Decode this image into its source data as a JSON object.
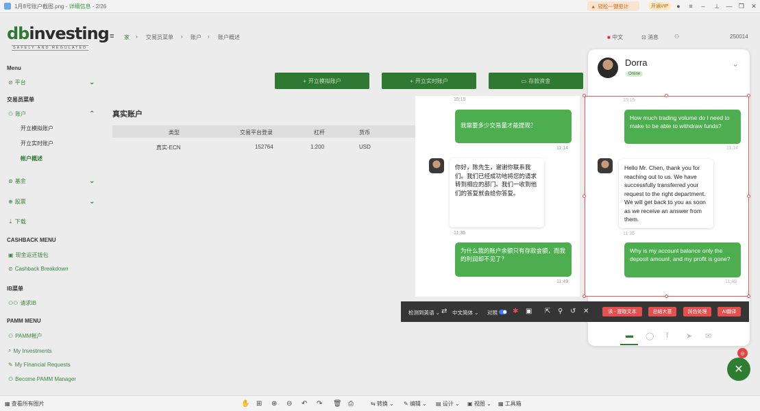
{
  "viewer": {
    "title": "1月8号账户截图.png",
    "title_sep": " - ",
    "title_status": "详细信息",
    "counter": " - 2/26",
    "promo": "轻松一键抠计",
    "vip": "开通VIP"
  },
  "app": {
    "logo_prefix": "db",
    "logo_main": "investing",
    "logo_sub": "SAFELY AND REGULATED",
    "breadcrumbs": [
      "家",
      "交易员菜单",
      "账户",
      "账户概述"
    ],
    "lang": "中文",
    "messages": "消息",
    "account_id": "250014",
    "sidebar": {
      "menu_title": "Menu",
      "platform": "平台",
      "trader_menu": "交易员菜单",
      "accounts": "账户",
      "open_demo": "开立模拟账户",
      "open_live": "开立实时账户",
      "account_overview": "帐户概述",
      "funds": "基金",
      "stocks": "股票",
      "download": "下载",
      "cashback_menu": "CASHBACK MENU",
      "cashback_wallet": "现金返还钱包",
      "cashback_breakdown": "Cashback Breakdown",
      "ib_menu": "IB菜单",
      "request_ib": "请求IB",
      "pamm_menu": "PAMM MENU",
      "pamm_account": "PAMM帐户",
      "my_investments": "My Investments",
      "my_financial_requests": "My Financial Requests",
      "become_pamm": "Become PAMM Manager"
    },
    "buttons": {
      "open_demo": "开立模拟账户",
      "open_live": "开立实时账户",
      "deposit": "存款资金"
    },
    "section_title": "真实账户",
    "table": {
      "headers": [
        "类型",
        "交易平台登录",
        "杠杆",
        "货币"
      ],
      "rows": [
        [
          "真实-ECN",
          "152764",
          "1:200",
          "USD"
        ]
      ]
    },
    "bottom_bar": {
      "view_all": "查看所有图片",
      "convert": "转换",
      "edit": "编辑",
      "design": "设计",
      "view": "视图",
      "toolbox": "工具箱"
    }
  },
  "chat": {
    "agent_name": "Dorra",
    "status": "Online",
    "left_pane": {
      "t1": "15:15",
      "m1": "我需要多少交易量才能提现？",
      "t2": "11:14",
      "m2": "你好，陈先生，谢谢你联系我们。我们已经成功地将您的请求转到相应的部门。我们一收到他们的答复就会给你答复。",
      "t3": "11:36",
      "m3": "为什么我的账户余额只有存款金额，而我的利润却不见了？",
      "t4": "11:49"
    },
    "right_pane": {
      "t1": "15:15",
      "m1": "How much trading volume do I need to make to be able to withdraw funds?",
      "t2": "11:14",
      "m2": "Hello Mr. Chen, thank you for reaching out to us. We have successfully transferred your request to the right department. We will get back to you as soon as we receive an answer from them.",
      "t3": "11:36",
      "m3": "Why is my account balance only the deposit amount, and my profit is gone?",
      "t4": "11:49"
    }
  },
  "translate_toolbar": {
    "source": "检测到英语",
    "target": "中文简体",
    "compare": "对照",
    "extract": "读 - 提取文本",
    "summarize": "总结大意",
    "polish": "润色处理",
    "ai_translate": "AI翻译"
  }
}
